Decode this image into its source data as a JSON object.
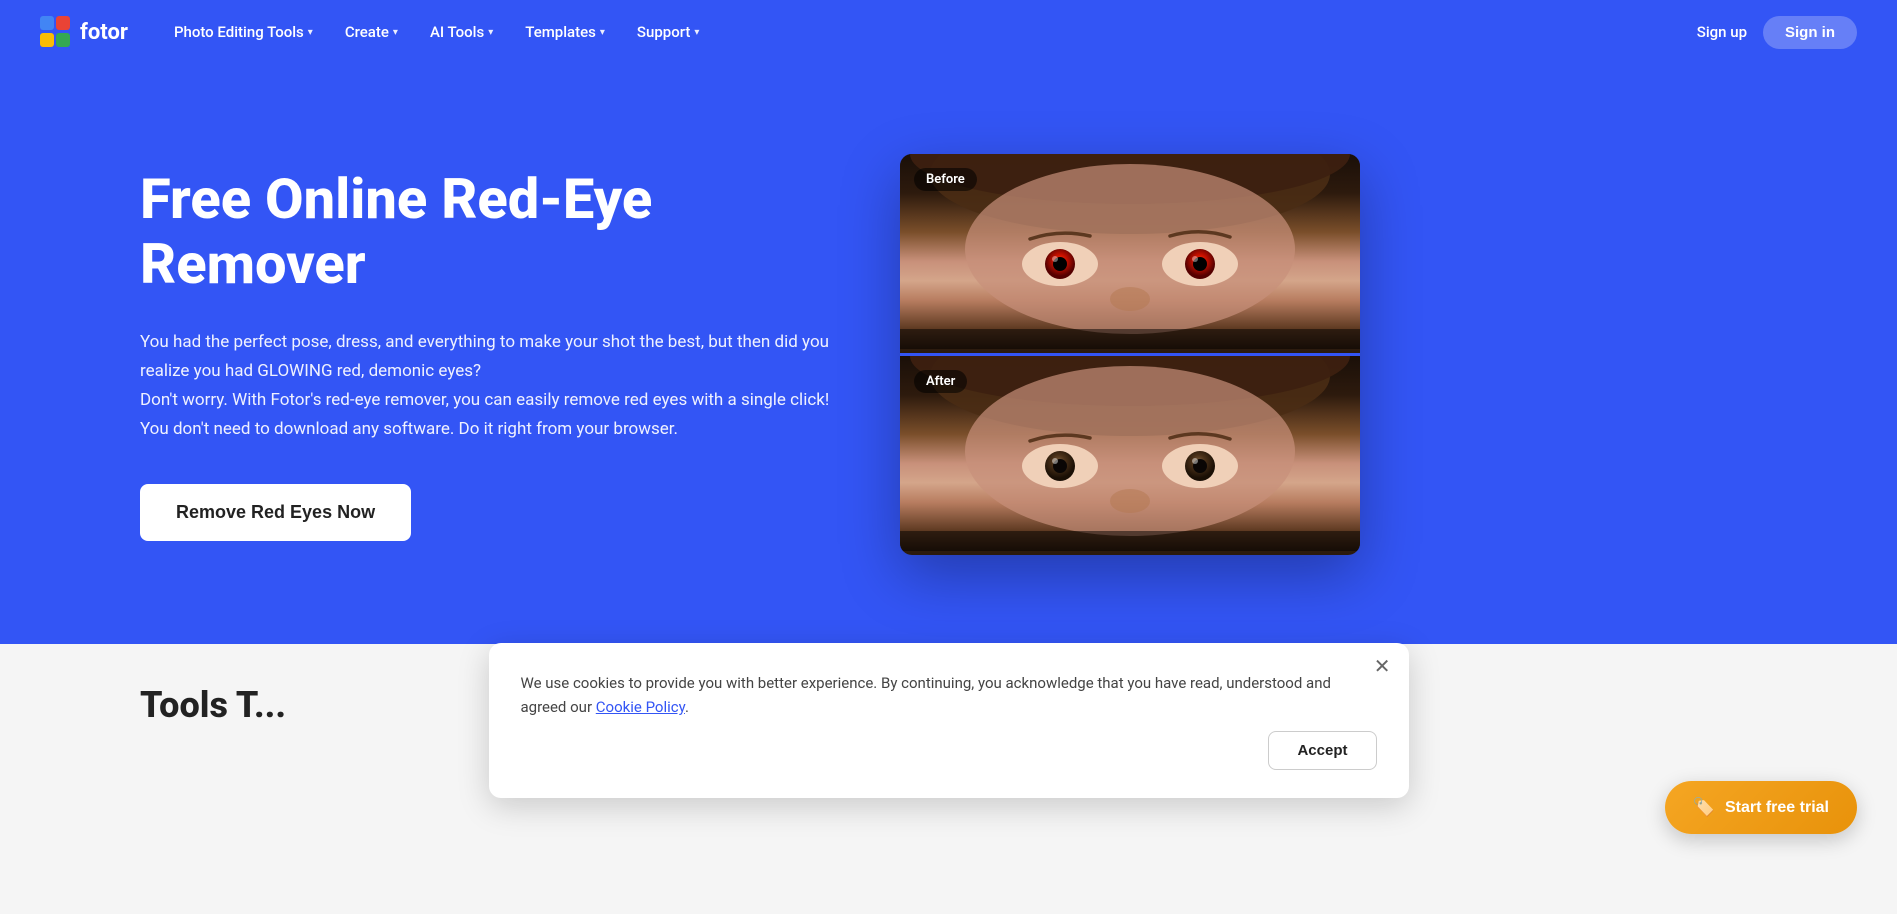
{
  "brand": {
    "logo_text": "fotor",
    "logo_colors": [
      "#4285F4",
      "#EA4335",
      "#FBBC04",
      "#34A853"
    ]
  },
  "nav": {
    "items": [
      {
        "label": "Photo Editing Tools",
        "has_dropdown": true
      },
      {
        "label": "Create",
        "has_dropdown": true
      },
      {
        "label": "AI Tools",
        "has_dropdown": true
      },
      {
        "label": "Templates",
        "has_dropdown": true
      },
      {
        "label": "Support",
        "has_dropdown": true
      }
    ],
    "signup_label": "Sign up",
    "signin_label": "Sign in"
  },
  "hero": {
    "title": "Free Online Red-Eye Remover",
    "description": "You had the perfect pose, dress, and everything to make your shot the best, but then did you realize you had GLOWING red, demonic eyes?\nDon't worry. With Fotor's red-eye remover, you can easily remove red eyes with a single click!\nYou don't need to download any software. Do it right from your browser.",
    "cta_label": "Remove Red Eyes Now",
    "before_label": "Before",
    "after_label": "After"
  },
  "lower": {
    "partial_title": "Tools T..."
  },
  "cookie": {
    "text": "We use cookies to provide you with better experience. By continuing, you acknowledge that you have read, understood and agreed our",
    "link_text": "Cookie Policy",
    "period": ".",
    "accept_label": "Accept"
  },
  "trial": {
    "label": "Start free trial",
    "icon": "🏷"
  }
}
